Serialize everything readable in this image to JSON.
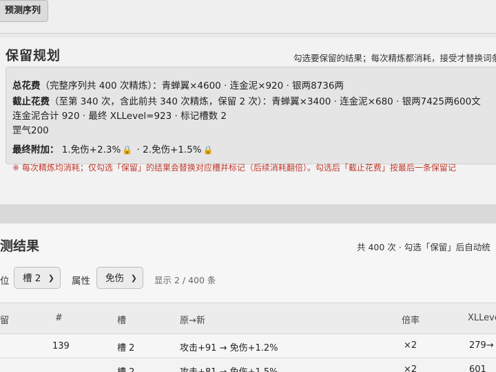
{
  "toolbar": {
    "predict_button": "预测序列"
  },
  "plan": {
    "title": "保留规划",
    "hint": "勾选要保留的结果；每次精炼都消耗，接受才替换词条",
    "total_label": "总花费",
    "total_note": "（完整序列共 400 次精炼）：青蝉翼×4600 · 连金泥×920 · 银两8736两",
    "cutoff_label": "截止花费",
    "cutoff_note": "（至第 340 次，含此前共 340 次精炼，保留 2 次）：青蝉翼×3400 · 连金泥×680 · 银两7425两600文",
    "cutoff_line2": "连金泥合计 920 · 最终 XLLevel=923 · 标记槽数 2",
    "cutoff_line3": "罡气200",
    "final_label": "最终附加：",
    "final_item1": "1.免伤+2.3%",
    "final_sep": "·",
    "final_item2": "2.免伤+1.5%",
    "warning": "※ 每次精炼均消耗；仅勾选「保留」的结果会替换对应槽并标记（后续消耗翻倍）。勾选后「截止花费」按最后一条保留记"
  },
  "results": {
    "title": "测结果",
    "hint": "共 400 次 · 勾选「保留」后自动统",
    "filter_slot_label": "位",
    "filter_slot_value": "槽 2",
    "filter_attr_label": "属性",
    "filter_attr_value": "免伤",
    "count": "显示 2 / 400 条",
    "columns": [
      "留",
      "#",
      "槽",
      "原→新",
      "倍率",
      "XLLevel"
    ],
    "rows": [
      {
        "index": "139",
        "slot": "槽 2",
        "change": "攻击+91 → 免伤+1.2%",
        "multiplier": "×2",
        "xllevel": "279→"
      },
      {
        "index": "",
        "slot": "槽 2",
        "change": "攻击+81 → 免伤+1.5%",
        "multiplier": "×2",
        "xllevel": "601"
      }
    ]
  },
  "icons": {
    "lock": "lock-icon",
    "chevron": "chevron-down-icon"
  },
  "colors": {
    "warning": "#c0392b",
    "lock": "#c98a12"
  }
}
